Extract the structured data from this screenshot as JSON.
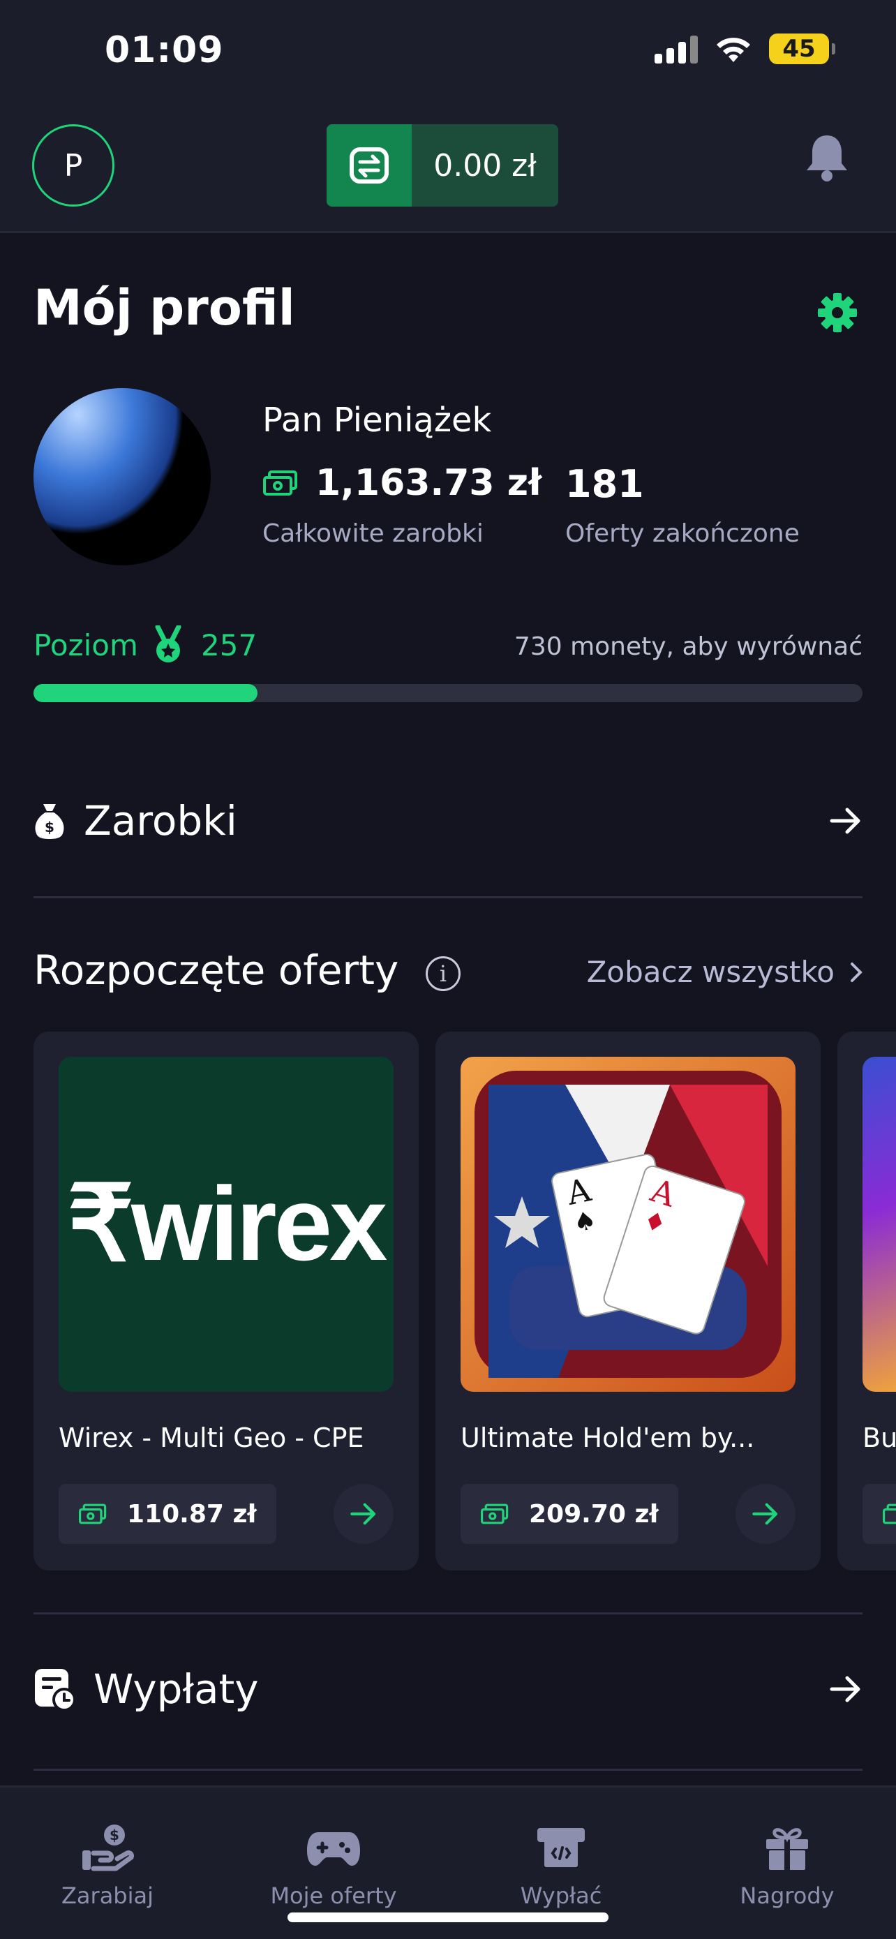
{
  "status_bar": {
    "time": "01:09",
    "battery": "45"
  },
  "header": {
    "avatar_initial": "P",
    "balance": "0.00 zł"
  },
  "profile": {
    "title": "Mój profil",
    "name": "Pan Pieniążek",
    "earnings_value": "1,163.73 zł",
    "earnings_label": "Całkowite zarobki",
    "offers_value": "181",
    "offers_label": "Oferty zakończone",
    "level_label": "Poziom",
    "level_value": "257",
    "level_hint": "730 monety, aby wyrównać",
    "level_progress_fraction": 0.27
  },
  "sections": {
    "earnings": "Zarobki",
    "started_offers": "Rozpoczęte oferty",
    "see_all": "Zobacz wszystko",
    "payouts": "Wypłaty"
  },
  "offers": [
    {
      "logo_text": "₹wirex",
      "title": "Wirex - Multi Geo - CPE",
      "price": "110.87 zł"
    },
    {
      "title": "Ultimate Hold'em by...",
      "price": "209.70 zł"
    },
    {
      "title": "Bu",
      "price": ""
    }
  ],
  "nav": [
    {
      "label": "Zarabiaj",
      "icon": "hand-coin-icon"
    },
    {
      "label": "Moje oferty",
      "icon": "gamepad-icon"
    },
    {
      "label": "Wypłać",
      "icon": "withdraw-icon"
    },
    {
      "label": "Nagrody",
      "icon": "gift-icon"
    }
  ],
  "colors": {
    "accent": "#1fd47a",
    "background": "#13141f",
    "surface": "#1f2030"
  }
}
